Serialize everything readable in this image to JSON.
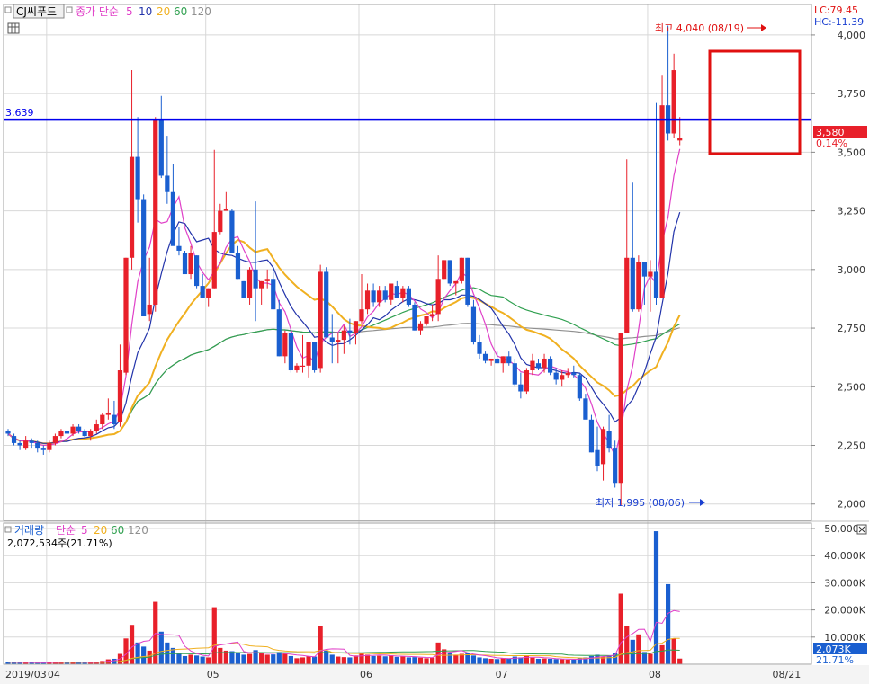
{
  "header": {
    "symbol": "CJ씨푸드",
    "price_title": "종가 단순",
    "ma_periods": [
      "5",
      "10",
      "20",
      "60",
      "120"
    ],
    "lc": "LC:79.45",
    "hc": "HC:-11.39"
  },
  "volume_header": {
    "title": "거래량",
    "ma_label": "단순",
    "ma_periods": [
      "5",
      "20",
      "60",
      "120"
    ],
    "current": "2,072,534주(21.71%)"
  },
  "annotations": {
    "high": "최고 4,040 (08/19)",
    "low": "최저 1,995 (08/06)",
    "hline_value": 3639,
    "hline_label": "3,639",
    "last_price": "3,580",
    "last_change": "0.14%",
    "vol_current": "2,073K",
    "vol_pct": "21.71%"
  },
  "colors": {
    "up": "#e8202a",
    "down": "#1a5fd0",
    "ma5": "#e040c8",
    "ma10": "#2233aa",
    "ma20": "#f0b020",
    "ma60": "#30a050",
    "ma120": "#909090",
    "hline": "#0000ee",
    "highlight": "#e01010",
    "grid": "#d8d8d8"
  },
  "chart_data": {
    "type": "candlestick",
    "price_axis": {
      "min": 1930,
      "max": 4130,
      "ticks": [
        4000,
        3750,
        3500,
        3250,
        3000,
        2750,
        2500,
        2250,
        2000
      ],
      "tick_labels": [
        "4,000",
        "3,750",
        "3,500",
        "3,250",
        "3,000",
        "2,750",
        "2,500",
        "2,250",
        "2,000"
      ]
    },
    "volume_axis": {
      "min": 0,
      "max": 52000,
      "ticks": [
        50000,
        40000,
        30000,
        20000,
        10000
      ],
      "tick_labels": [
        "50,000K",
        "40,000K",
        "30,000K",
        "20,000K",
        "10,000K"
      ]
    },
    "x_labels": [
      {
        "idx": 0,
        "text": "2019/03"
      },
      {
        "idx": 7,
        "text": "04"
      },
      {
        "idx": 34,
        "text": "05"
      },
      {
        "idx": 60,
        "text": "06"
      },
      {
        "idx": 83,
        "text": "07"
      },
      {
        "idx": 109,
        "text": "08"
      },
      {
        "idx": 130,
        "text": "08/21"
      }
    ],
    "candles": [
      [
        2310,
        2320,
        2290,
        2300,
        800
      ],
      [
        2290,
        2300,
        2250,
        2260,
        700
      ],
      [
        2260,
        2270,
        2230,
        2250,
        600
      ],
      [
        2240,
        2290,
        2230,
        2270,
        650
      ],
      [
        2270,
        2280,
        2240,
        2260,
        500
      ],
      [
        2260,
        2270,
        2220,
        2240,
        600
      ],
      [
        2240,
        2250,
        2210,
        2230,
        700
      ],
      [
        2230,
        2270,
        2220,
        2260,
        800
      ],
      [
        2260,
        2300,
        2250,
        2290,
        900
      ],
      [
        2290,
        2320,
        2280,
        2310,
        850
      ],
      [
        2310,
        2320,
        2290,
        2300,
        700
      ],
      [
        2300,
        2340,
        2290,
        2330,
        800
      ],
      [
        2330,
        2340,
        2300,
        2310,
        700
      ],
      [
        2310,
        2320,
        2280,
        2290,
        650
      ],
      [
        2290,
        2320,
        2270,
        2310,
        700
      ],
      [
        2310,
        2360,
        2300,
        2340,
        900
      ],
      [
        2340,
        2390,
        2320,
        2380,
        1200
      ],
      [
        2380,
        2450,
        2360,
        2390,
        1800
      ],
      [
        2380,
        2440,
        2320,
        2340,
        2000
      ],
      [
        2350,
        2680,
        2330,
        2570,
        3800
      ],
      [
        2560,
        3050,
        2550,
        3050,
        9500
      ],
      [
        3050,
        3850,
        3000,
        3480,
        14500
      ],
      [
        3480,
        3650,
        3200,
        3300,
        8000
      ],
      [
        3300,
        3320,
        2850,
        2800,
        6500
      ],
      [
        2810,
        3050,
        2780,
        2850,
        5000
      ],
      [
        2850,
        3650,
        2820,
        3640,
        23000
      ],
      [
        3640,
        3740,
        3390,
        3400,
        12000
      ],
      [
        3400,
        3570,
        3280,
        3330,
        8000
      ],
      [
        3330,
        3450,
        3120,
        3100,
        6000
      ],
      [
        3100,
        3180,
        3060,
        3080,
        4000
      ],
      [
        3070,
        3080,
        2980,
        2980,
        3000
      ],
      [
        2980,
        3100,
        2960,
        3070,
        3500
      ],
      [
        3060,
        3060,
        2920,
        2930,
        3200
      ],
      [
        2930,
        2980,
        2880,
        2880,
        2800
      ],
      [
        2880,
        2920,
        2840,
        2920,
        2500
      ],
      [
        2920,
        3510,
        2920,
        3160,
        21000
      ],
      [
        3160,
        3280,
        3150,
        3250,
        6000
      ],
      [
        3250,
        3330,
        3260,
        3260,
        5000
      ],
      [
        3250,
        3260,
        3080,
        3070,
        4800
      ],
      [
        3070,
        3100,
        2960,
        2960,
        4000
      ],
      [
        2950,
        2950,
        2880,
        2880,
        3500
      ],
      [
        2880,
        3010,
        2850,
        3000,
        3800
      ],
      [
        3000,
        3290,
        2780,
        2920,
        5200
      ],
      [
        2920,
        2950,
        2850,
        2950,
        4000
      ],
      [
        2950,
        3000,
        2920,
        2960,
        3500
      ],
      [
        2960,
        3010,
        2830,
        2830,
        3600
      ],
      [
        2830,
        2870,
        2630,
        2630,
        4500
      ],
      [
        2630,
        2740,
        2600,
        2730,
        3800
      ],
      [
        2730,
        2750,
        2560,
        2570,
        3000
      ],
      [
        2570,
        2600,
        2560,
        2590,
        2200
      ],
      [
        2590,
        2720,
        2560,
        2590,
        2500
      ],
      [
        2590,
        2690,
        2540,
        2690,
        3000
      ],
      [
        2690,
        2680,
        2560,
        2570,
        2800
      ],
      [
        2580,
        3020,
        2560,
        2990,
        14000
      ],
      [
        2990,
        3010,
        2770,
        2710,
        5000
      ],
      [
        2710,
        2810,
        2600,
        2690,
        3500
      ],
      [
        2690,
        2730,
        2600,
        2700,
        2800
      ],
      [
        2700,
        2760,
        2640,
        2740,
        2600
      ],
      [
        2740,
        2790,
        2680,
        2730,
        2500
      ],
      [
        2730,
        2780,
        2680,
        2780,
        3200
      ],
      [
        2780,
        2980,
        2770,
        2830,
        4200
      ],
      [
        2830,
        2940,
        2810,
        2910,
        3500
      ],
      [
        2910,
        2940,
        2840,
        2860,
        3000
      ],
      [
        2860,
        2930,
        2840,
        2910,
        3100
      ],
      [
        2910,
        2930,
        2860,
        2870,
        2900
      ],
      [
        2870,
        2940,
        2850,
        2940,
        3300
      ],
      [
        2930,
        2950,
        2880,
        2880,
        2700
      ],
      [
        2880,
        2930,
        2860,
        2920,
        2800
      ],
      [
        2920,
        2930,
        2840,
        2850,
        2500
      ],
      [
        2850,
        2860,
        2740,
        2740,
        2600
      ],
      [
        2740,
        2780,
        2720,
        2770,
        2400
      ],
      [
        2770,
        2800,
        2760,
        2800,
        2200
      ],
      [
        2800,
        2850,
        2780,
        2810,
        2400
      ],
      [
        2810,
        3060,
        2780,
        2960,
        8000
      ],
      [
        2960,
        3040,
        2960,
        3040,
        5500
      ],
      [
        3040,
        3040,
        2930,
        2940,
        4200
      ],
      [
        2940,
        2950,
        2890,
        2950,
        3500
      ],
      [
        2950,
        3050,
        2940,
        3050,
        3800
      ],
      [
        3050,
        3050,
        2840,
        2850,
        4000
      ],
      [
        2840,
        2870,
        2680,
        2690,
        3200
      ],
      [
        2690,
        2720,
        2620,
        2640,
        2500
      ],
      [
        2640,
        2650,
        2600,
        2610,
        2200
      ],
      [
        2610,
        2620,
        2590,
        2620,
        2000
      ],
      [
        2620,
        2650,
        2600,
        2600,
        1900
      ],
      [
        2600,
        2630,
        2560,
        2630,
        2300
      ],
      [
        2630,
        2650,
        2590,
        2600,
        2100
      ],
      [
        2600,
        2620,
        2500,
        2510,
        2800
      ],
      [
        2510,
        2560,
        2450,
        2480,
        2500
      ],
      [
        2480,
        2580,
        2470,
        2570,
        3000
      ],
      [
        2570,
        2640,
        2550,
        2610,
        2400
      ],
      [
        2600,
        2620,
        2570,
        2580,
        2000
      ],
      [
        2580,
        2640,
        2560,
        2620,
        2100
      ],
      [
        2620,
        2630,
        2550,
        2560,
        2000
      ],
      [
        2560,
        2580,
        2510,
        2530,
        1900
      ],
      [
        2530,
        2570,
        2500,
        2550,
        1800
      ],
      [
        2550,
        2580,
        2540,
        2560,
        1700
      ],
      [
        2560,
        2590,
        2540,
        2550,
        1700
      ],
      [
        2550,
        2560,
        2440,
        2450,
        2200
      ],
      [
        2450,
        2470,
        2370,
        2360,
        2500
      ],
      [
        2360,
        2380,
        2220,
        2220,
        3000
      ],
      [
        2230,
        2330,
        2140,
        2160,
        3500
      ],
      [
        2170,
        2330,
        2100,
        2320,
        2800
      ],
      [
        2310,
        2380,
        2220,
        2240,
        3300
      ],
      [
        2240,
        2270,
        2070,
        2090,
        4200
      ],
      [
        2090,
        2730,
        1995,
        2730,
        26000
      ],
      [
        2730,
        3470,
        2730,
        3050,
        14000
      ],
      [
        3050,
        3370,
        2820,
        2830,
        9000
      ],
      [
        2830,
        3060,
        2820,
        3030,
        11000
      ],
      [
        3030,
        3020,
        2850,
        2970,
        4500
      ],
      [
        2970,
        3040,
        2820,
        2990,
        3800
      ],
      [
        2990,
        3710,
        2850,
        2880,
        49000
      ],
      [
        2880,
        3830,
        2880,
        3700,
        7000
      ],
      [
        3700,
        4040,
        3550,
        3580,
        29500
      ],
      [
        3580,
        3920,
        3560,
        3850,
        9500
      ],
      [
        3550,
        3650,
        3530,
        3560,
        2073
      ]
    ]
  }
}
